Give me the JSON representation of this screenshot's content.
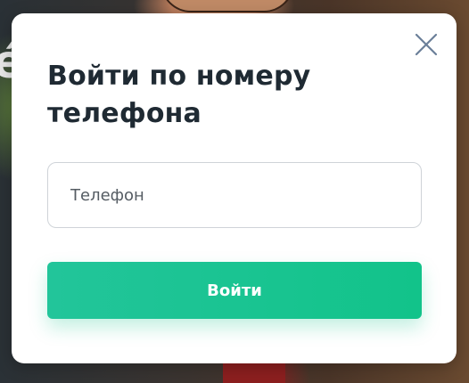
{
  "modal": {
    "title": "Войти по номеру телефона",
    "close_icon": "close-icon",
    "phone_input": {
      "placeholder": "Телефон",
      "value": ""
    },
    "submit_label": "Войти"
  },
  "background": {
    "partial_letter": "é"
  },
  "colors": {
    "accent": "#12c38a",
    "title_text": "#1f2a33",
    "close_icon": "#6b7f99",
    "input_border": "#cfd3d8"
  }
}
